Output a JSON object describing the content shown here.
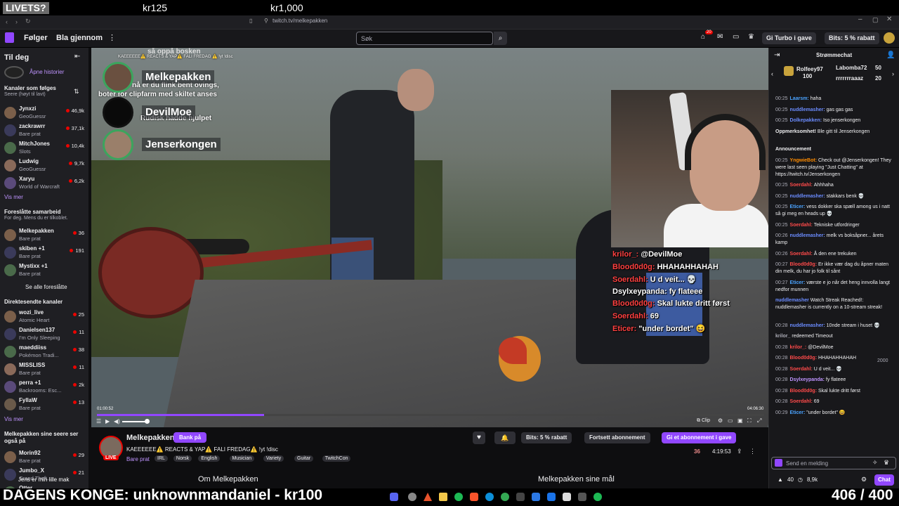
{
  "overlay": {
    "badge": "LIVETS?",
    "amount1": "kr125",
    "amount2": "kr1,000"
  },
  "browser": {
    "url": "twitch.tv/melkepakken"
  },
  "nav": {
    "following": "Følger",
    "browse": "Bla gjennom",
    "search_placeholder": "Søk",
    "turbo": "Gi Turbo i gave",
    "bits": "Bits: 5 % rabatt",
    "notifications": "20"
  },
  "sidebar": {
    "title": "Til deg",
    "history": "Åpne historier",
    "followed_title": "Kanaler som følges",
    "followed_sub": "Seere (høyt til lavt)",
    "followed": [
      {
        "name": "Jynxzi",
        "game": "GeoGuessr",
        "viewers": "46,9k"
      },
      {
        "name": "zackrawrr",
        "game": "Bare prat",
        "viewers": "37,1k"
      },
      {
        "name": "MitchJones",
        "game": "Slots",
        "viewers": "10,4k"
      },
      {
        "name": "Ludwig",
        "game": "GeoGuessr",
        "viewers": "9,7k"
      },
      {
        "name": "Xaryu",
        "game": "World of Warcraft",
        "viewers": "6,2k"
      }
    ],
    "show_more": "Vis mer",
    "collab_title": "Foreslåtte samarbeid",
    "collab_sub": "For deg. Mens du er tilkoblet.",
    "collab": [
      {
        "name": "Melkepakken",
        "game": "Bare prat",
        "viewers": "36"
      },
      {
        "name": "skiben +1",
        "game": "Bare prat",
        "viewers": "191"
      },
      {
        "name": "Mystixx +1",
        "game": "Bare prat",
        "viewers": ""
      }
    ],
    "see_all": "Se alle foreslåtte",
    "direct_title": "Direktesendte kanaler",
    "direct": [
      {
        "name": "wozi_live",
        "game": "Atomic Heart",
        "viewers": "25"
      },
      {
        "name": "Danielsen137",
        "game": "I'm Only Sleeping",
        "viewers": "11"
      },
      {
        "name": "maeddiiss",
        "game": "Pokémon Tradi...",
        "viewers": "38"
      },
      {
        "name": "MISSLISS",
        "game": "Bare prat",
        "viewers": "11"
      },
      {
        "name": "perra +1",
        "game": "Backrooms: Esc...",
        "viewers": "2k"
      },
      {
        "name": "FyllaW",
        "game": "Bare prat",
        "viewers": "13"
      }
    ],
    "show_more2": "Vis mer",
    "also_title": "Melkepakken sine seere ser også på",
    "also": [
      {
        "name": "Morin92",
        "game": "Bare prat",
        "viewers": "29"
      },
      {
        "name": "Jumbo_X",
        "game": "Grand Theft...",
        "viewers": "21"
      },
      {
        "name": "Otter",
        "game": "",
        "viewers": ""
      }
    ]
  },
  "video": {
    "top_text": "KAEEEEEE⚠️ REACTS & YAP⚠️ FALI FREDAG ⚠️ !yt !disc",
    "discord": [
      "Melkepakken",
      "DevilMoe",
      "Jenserkongen"
    ],
    "discord_bg_lines": [
      "så oppå bosken",
      "nå er du flink bent ovings,",
      "boter for clipfarm med skiltet anses",
      "Rudisk hadde hjulpet"
    ],
    "overlay_chat": [
      {
        "user": "krilor_:",
        "msg": "@DevilMoe"
      },
      {
        "user": "Blood0d0g:",
        "msg": "HHAHAHHAHAH"
      },
      {
        "user": "Soerdahl:",
        "msg": "U d veit... 💀"
      },
      {
        "user": "Dsylxeypanda:",
        "msg": "fy flateee"
      },
      {
        "user": "Blood0d0g:",
        "msg": "Skal lukte dritt først"
      },
      {
        "user": "Soerdahl:",
        "msg": "69"
      },
      {
        "user": "Eticer:",
        "msg": "\"under bordet\" 😆"
      }
    ],
    "time_elapsed": "01:00:52",
    "time_total": "04:06:30",
    "progress": 0.25
  },
  "channel": {
    "name": "Melkepakken",
    "bank_btn": "Bank på",
    "title": "KAEEEEEE⚠️ REACTS & YAP⚠️ FALI FREDAG⚠️ !yt !disc",
    "category": "Bare prat",
    "tags": [
      "IRL",
      "Norsk",
      "English",
      "Musician",
      "Variety",
      "Guitar",
      "TwitchCon"
    ],
    "live": "LIVE",
    "bits_btn": "Bits: 5 % rabatt",
    "resub_btn": "Fortsett abonnement",
    "gift_btn": "Gi et abonnement i gave",
    "viewers": "36",
    "uptime": "4:19:53",
    "about": "Om Melkepakken",
    "goals": "Melkepakken sine mål"
  },
  "chat": {
    "title": "Strømmechat",
    "top_gifters": [
      {
        "name": "Rolfeey97",
        "amount": "100"
      },
      {
        "name": "Labomba72",
        "amount": "50"
      },
      {
        "name": "rrrrrrraaaz",
        "amount": "20"
      }
    ],
    "messages": [
      {
        "time": "00:25",
        "user": "Laarsm:",
        "msg": "haha",
        "color": "#4aa3ff"
      },
      {
        "time": "00:25",
        "user": "nuddlemasher:",
        "msg": "gas gas gas",
        "color": "#6b8cff"
      },
      {
        "time": "00:25",
        "user": "Dolkepakken:",
        "msg": "Iso jenserkongen",
        "color": "#6b8cff"
      },
      {
        "time": "",
        "user": "Oppmerksomhet!",
        "msg": "Ble gitt til Jenserkongen",
        "color": "#efeff1"
      },
      {
        "time": "",
        "user": "Announcement",
        "msg": "",
        "color": "#efeff1"
      },
      {
        "time": "00:25",
        "user": "YngwieBot:",
        "msg": "Check out @Jenserkongen! They were last seen playing \"Just Chatting\" at https://twitch.tv/Jenserkongen",
        "color": "#ff8c00"
      },
      {
        "time": "00:25",
        "user": "Soerdahl:",
        "msg": "Ahhhaha",
        "color": "#ff4a4a"
      },
      {
        "time": "00:25",
        "user": "nuddlemasher:",
        "msg": "stakkars benk 💀",
        "color": "#6b8cff"
      },
      {
        "time": "00:25",
        "user": "Eticer:",
        "msg": "vess dokker ska spæll among us i natt så gi meg en heads up 💀",
        "color": "#4aa3ff"
      },
      {
        "time": "00:25",
        "user": "Soerdahl:",
        "msg": "Tekniske utfordringer",
        "color": "#ff4a4a"
      },
      {
        "time": "00:26",
        "user": "nuddlemasher:",
        "msg": "melk vs boksåpner... årets kamp",
        "color": "#6b8cff"
      },
      {
        "time": "00:26",
        "user": "Soerdahl:",
        "msg": "Å den ene trekuken",
        "color": "#ff4a4a"
      },
      {
        "time": "00:27",
        "user": "Blood0d0g:",
        "msg": "Er ikke vær dag du åpner maten din melk, du har jo folk til sånt",
        "color": "#ff4a4a"
      },
      {
        "time": "00:27",
        "user": "Eticer:",
        "msg": "værste e jo når det heng innvolla langt nedfor munnen",
        "color": "#4aa3ff"
      },
      {
        "time": "",
        "user": "nuddlemasher",
        "msg": "Watch Streak Reached!: nuddlemasher is currently on a 10-stream streak!",
        "color": "#6b8cff"
      },
      {
        "time": "00:28",
        "user": "nuddlemasher:",
        "msg": "10nde stream i huset 💀",
        "color": "#6b8cff"
      },
      {
        "time": "",
        "user": "krilor_",
        "msg": "redeemed Timeout",
        "color": "#adadb8"
      },
      {
        "time": "00:28",
        "user": "krilor_:",
        "msg": "@DevilMoe",
        "color": "#ff4a4a"
      },
      {
        "time": "00:28",
        "user": "Blood0d0g:",
        "msg": "HHAHAHHAHAH",
        "color": "#ff4a4a"
      },
      {
        "time": "00:28",
        "user": "Soerdahl:",
        "msg": "U d veit... 💀",
        "color": "#ff4a4a"
      },
      {
        "time": "00:28",
        "user": "Dsylxeypanda:",
        "msg": "fy flateee",
        "color": "#bf94ff"
      },
      {
        "time": "00:28",
        "user": "Blood0d0g:",
        "msg": "Skal lukte dritt først",
        "color": "#ff4a4a"
      },
      {
        "time": "00:28",
        "user": "Soerdahl:",
        "msg": "69",
        "color": "#ff4a4a"
      },
      {
        "time": "00:29",
        "user": "Eticer:",
        "msg": "\"under bordet\" 😆",
        "color": "#4aa3ff"
      }
    ],
    "redeem_cost": "2000",
    "input_placeholder": "Send en melding",
    "bits_count": "40",
    "points": "8,9k",
    "chat_btn": "Chat"
  },
  "bottom": {
    "sidebar_tagline": "Jens er min lille mak",
    "banner": "DAGENS KONGE: unknownmandaniel - kr100",
    "counter": "406 / 400"
  },
  "colors": {
    "accent": "#9147ff",
    "live_red": "#eb0400",
    "bg": "#0e0e10"
  }
}
